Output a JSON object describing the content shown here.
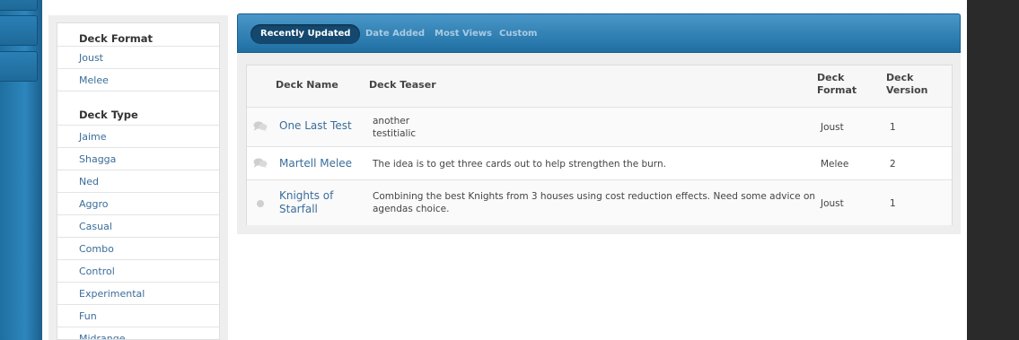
{
  "sidebar": {
    "deck_format_heading": "Deck Format",
    "formats": [
      "Joust",
      "Melee"
    ],
    "deck_type_heading": "Deck Type",
    "types": [
      "Jaime",
      "Shagga",
      "Ned",
      "Aggro",
      "Casual",
      "Combo",
      "Control",
      "Experimental",
      "Fun",
      "Midrange"
    ]
  },
  "tabs": {
    "recently_updated": "Recently Updated",
    "date_added": "Date Added",
    "most_views": "Most Views",
    "custom": "Custom"
  },
  "table": {
    "headers": {
      "name": "Deck Name",
      "teaser": "Deck Teaser",
      "format_line1": "Deck",
      "format_line2": "Format",
      "version_line1": "Deck",
      "version_line2": "Version"
    },
    "rows": [
      {
        "icon": "speech-bubbles-icon",
        "name": "One Last Test",
        "teaser_line1": "another",
        "teaser_line2": "testitialic",
        "format": "Joust",
        "version": "1"
      },
      {
        "icon": "speech-bubbles-icon",
        "name": "Martell Melee",
        "teaser_line1": "The idea is to get three cards out to help strengthen the burn.",
        "format": "Melee",
        "version": "2"
      },
      {
        "icon": "dot-icon",
        "name_line1": "Knights of",
        "name_line2": "Starfall",
        "teaser_line1": "Combining the best Knights from 3 houses using cost reduction effects. Need some advice on",
        "teaser_line2": "agendas choice.",
        "format": "Joust",
        "version": "1"
      }
    ]
  },
  "colors": {
    "accent_blue": "#1f6fa3",
    "link": "#3a6d9a",
    "active_tab": "#14486e"
  }
}
